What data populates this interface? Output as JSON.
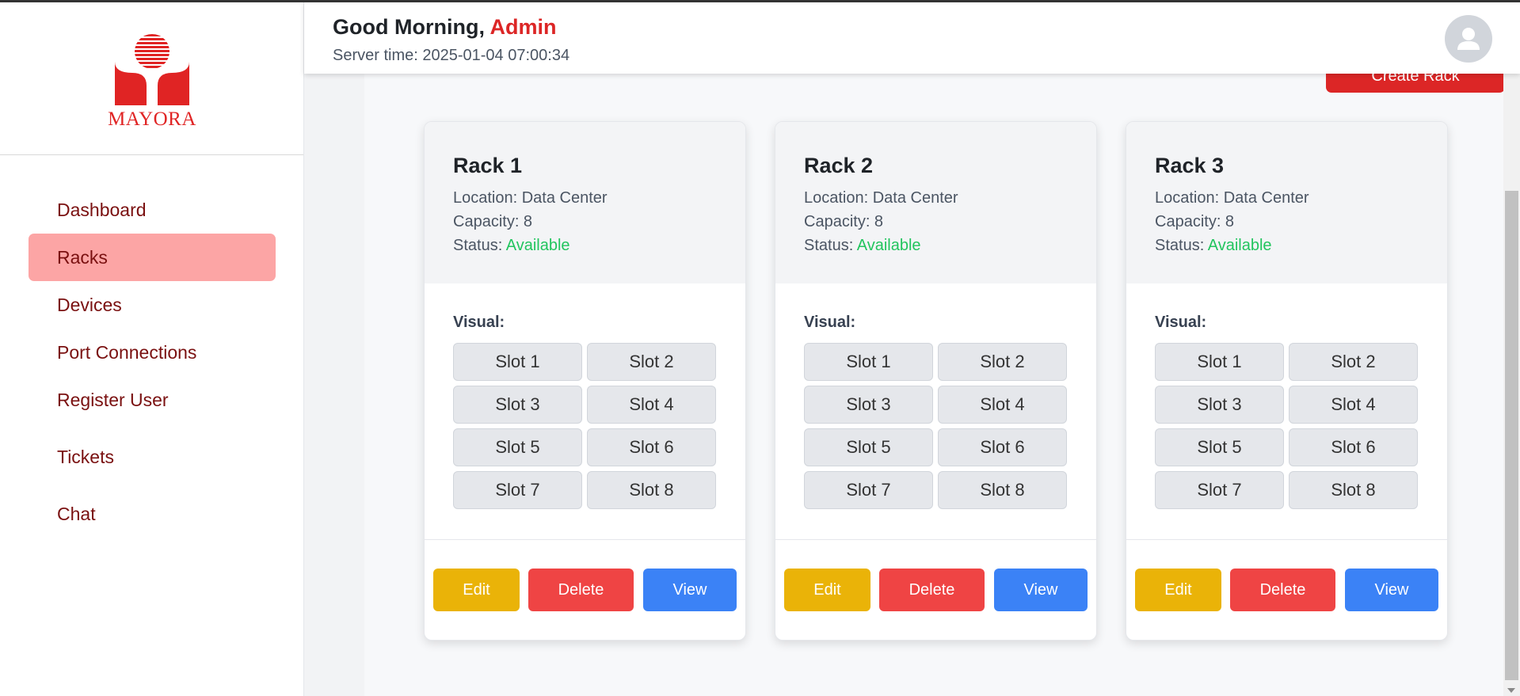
{
  "brand": {
    "name": "MAYORA",
    "color": "#e02424"
  },
  "sidebar": {
    "items": [
      {
        "label": "Dashboard",
        "active": false
      },
      {
        "label": "Racks",
        "active": true
      },
      {
        "label": "Devices",
        "active": false
      },
      {
        "label": "Port Connections",
        "active": false
      },
      {
        "label": "Register User",
        "active": false
      },
      {
        "label": "Tickets",
        "active": false
      },
      {
        "label": "Chat",
        "active": false
      }
    ]
  },
  "header": {
    "greeting": "Good Morning,",
    "user": "Admin",
    "server_time": "Server time: 2025-01-04 07:00:34",
    "avatar_icon": "user-avatar-icon"
  },
  "main": {
    "create_button_label": "Create Rack",
    "racks": [
      {
        "name": "Rack 1",
        "location": "Location: Data Center",
        "capacity": "Capacity: 8",
        "status_label": "Status:",
        "status_value": "Available",
        "visual_label": "Visual:",
        "slots": [
          "Slot 1",
          "Slot 2",
          "Slot 3",
          "Slot 4",
          "Slot 5",
          "Slot 6",
          "Slot 7",
          "Slot 8"
        ],
        "actions": {
          "edit": "Edit",
          "delete": "Delete",
          "view": "View"
        }
      },
      {
        "name": "Rack 2",
        "location": "Location: Data Center",
        "capacity": "Capacity: 8",
        "status_label": "Status:",
        "status_value": "Available",
        "visual_label": "Visual:",
        "slots": [
          "Slot 1",
          "Slot 2",
          "Slot 3",
          "Slot 4",
          "Slot 5",
          "Slot 6",
          "Slot 7",
          "Slot 8"
        ],
        "actions": {
          "edit": "Edit",
          "delete": "Delete",
          "view": "View"
        }
      },
      {
        "name": "Rack 3",
        "location": "Location: Data Center",
        "capacity": "Capacity: 8",
        "status_label": "Status:",
        "status_value": "Available",
        "visual_label": "Visual:",
        "slots": [
          "Slot 1",
          "Slot 2",
          "Slot 3",
          "Slot 4",
          "Slot 5",
          "Slot 6",
          "Slot 7",
          "Slot 8"
        ],
        "actions": {
          "edit": "Edit",
          "delete": "Delete",
          "view": "View"
        }
      }
    ]
  },
  "colors": {
    "accent": "#dc2626",
    "active_nav": "#fca5a5",
    "status_available": "#22c55e",
    "edit": "#eab308",
    "delete": "#ef4444",
    "view": "#3b82f6"
  }
}
